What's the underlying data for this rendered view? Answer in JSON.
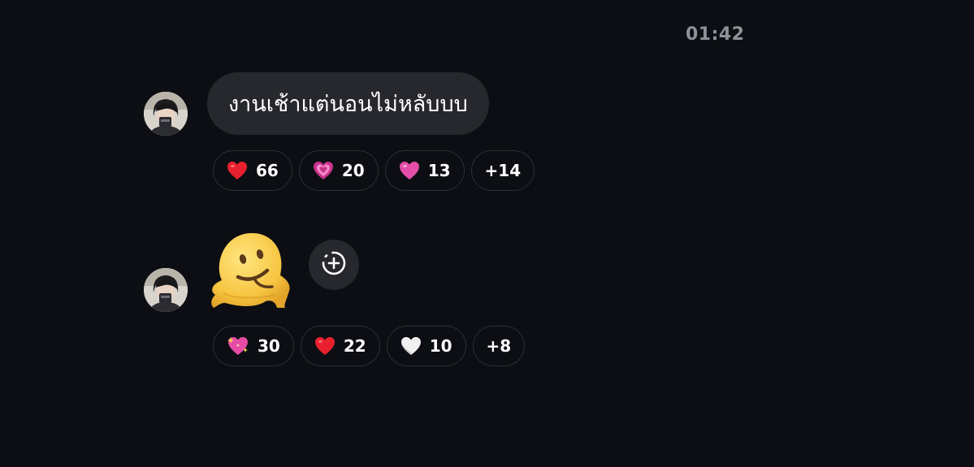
{
  "timestamp": "01:42",
  "messages": [
    {
      "text": "งานเช้าแต่นอนไม่หลับบบ",
      "reactions": [
        {
          "icon": "red-heart-icon",
          "count": "66"
        },
        {
          "icon": "growing-heart-icon",
          "count": "20"
        },
        {
          "icon": "pink-heart-icon",
          "count": "13"
        }
      ],
      "more": "+14"
    },
    {
      "sticker_icon": "melting-face-icon",
      "reactions": [
        {
          "icon": "sparkling-heart-icon",
          "count": "30"
        },
        {
          "icon": "red-heart-icon",
          "count": "22"
        },
        {
          "icon": "white-heart-icon",
          "count": "10"
        }
      ],
      "more": "+8"
    }
  ],
  "colors": {
    "background": "#0c0e13",
    "bubble": "#26282d",
    "pill_border": "#2c2f35",
    "timestamp": "#8e9196",
    "red_heart": "#e8202e",
    "pink_heart": "#e44ea8",
    "white_heart": "#f0f0f0"
  }
}
